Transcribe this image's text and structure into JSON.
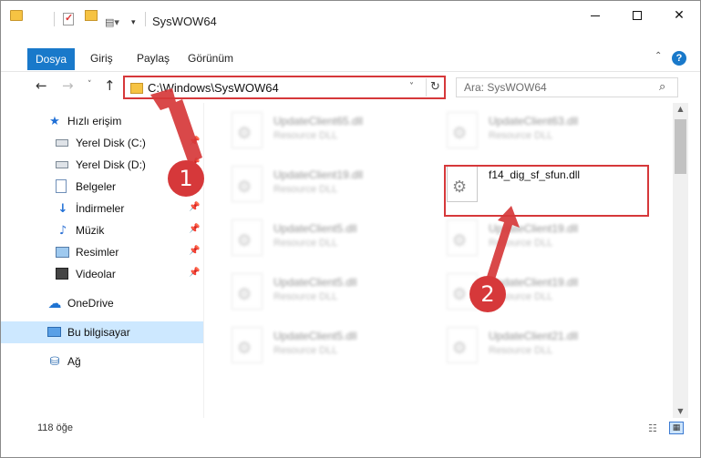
{
  "window": {
    "title": "SysWOW64",
    "minimize_glyph": "",
    "maximize_glyph": "",
    "close_glyph": "✕"
  },
  "quick_access": {
    "view_glyph": "▤▾",
    "dropdown_glyph": "▾"
  },
  "ribbon": {
    "tabs": [
      {
        "label": "Dosya"
      },
      {
        "label": "Giriş"
      },
      {
        "label": "Paylaş"
      },
      {
        "label": "Görünüm"
      }
    ],
    "collapse_glyph": "⌃",
    "help_glyph": "?"
  },
  "nav": {
    "back_glyph": "←",
    "forward_glyph": "→",
    "recent_glyph": "˅",
    "up_glyph": "↑"
  },
  "address": {
    "path": "C:\\Windows\\SysWOW64",
    "dropdown_glyph": "˅",
    "refresh_glyph": "↻"
  },
  "search": {
    "placeholder": "Ara: SysWOW64",
    "icon_glyph": "⌕"
  },
  "sidebar": {
    "items": [
      {
        "label": "Hızlı erişim",
        "icon": "star-icon",
        "glyph": "★",
        "pinned": false
      },
      {
        "label": "Yerel Disk (C:)",
        "icon": "drive-icon",
        "glyph": "",
        "pinned": true
      },
      {
        "label": "Yerel Disk (D:)",
        "icon": "drive-icon",
        "glyph": "",
        "pinned": true
      },
      {
        "label": "Belgeler",
        "icon": "documents-icon",
        "glyph": "",
        "pinned": true
      },
      {
        "label": "İndirmeler",
        "icon": "download-icon",
        "glyph": "↓",
        "pinned": true
      },
      {
        "label": "Müzik",
        "icon": "music-icon",
        "glyph": "♪",
        "pinned": true
      },
      {
        "label": "Resimler",
        "icon": "pictures-icon",
        "glyph": "",
        "pinned": true
      },
      {
        "label": "Videolar",
        "icon": "video-icon",
        "glyph": "",
        "pinned": true
      },
      {
        "label": "OneDrive",
        "icon": "cloud-icon",
        "glyph": "☁",
        "pinned": false
      },
      {
        "label": "Bu bilgisayar",
        "icon": "computer-icon",
        "glyph": "",
        "pinned": false,
        "selected": true
      },
      {
        "label": "Ağ",
        "icon": "network-icon",
        "glyph": "⛁",
        "pinned": false
      }
    ],
    "pin_glyph": "📌"
  },
  "files": {
    "left_column": [
      {
        "name": "UpdateClient65.dll",
        "type": "Resource DLL"
      },
      {
        "name": "UpdateClient19.dll",
        "type": "Resource DLL"
      },
      {
        "name": "UpdateClient5.dll",
        "type": "Resource DLL"
      },
      {
        "name": "UpdateClient5.dll",
        "type": "Resource DLL"
      },
      {
        "name": "UpdateClient5.dll",
        "type": "Resource DLL"
      }
    ],
    "right_column": [
      {
        "name": "UpdateClient63.dll",
        "type": "Resource DLL"
      },
      {
        "name": "f14_dig_sf_sfun.dll",
        "type": "",
        "highlighted": true
      },
      {
        "name": "UpdateClient19.dll",
        "type": "Resource DLL"
      },
      {
        "name": "UpdateClient19.dll",
        "type": "Resource DLL"
      },
      {
        "name": "UpdateClient21.dll",
        "type": "Resource DLL"
      }
    ]
  },
  "scrollbar": {
    "up_glyph": "▲",
    "down_glyph": "▼"
  },
  "status": {
    "item_count": "118 öğe",
    "details_view_glyph": "☷",
    "tiles_view_glyph": "▦"
  },
  "annotations": {
    "step1": "1",
    "step2": "2",
    "color": "#d6383a"
  },
  "colors": {
    "accent": "#1979ca",
    "selection": "#cde8ff",
    "annotation_red": "#d6383a"
  }
}
